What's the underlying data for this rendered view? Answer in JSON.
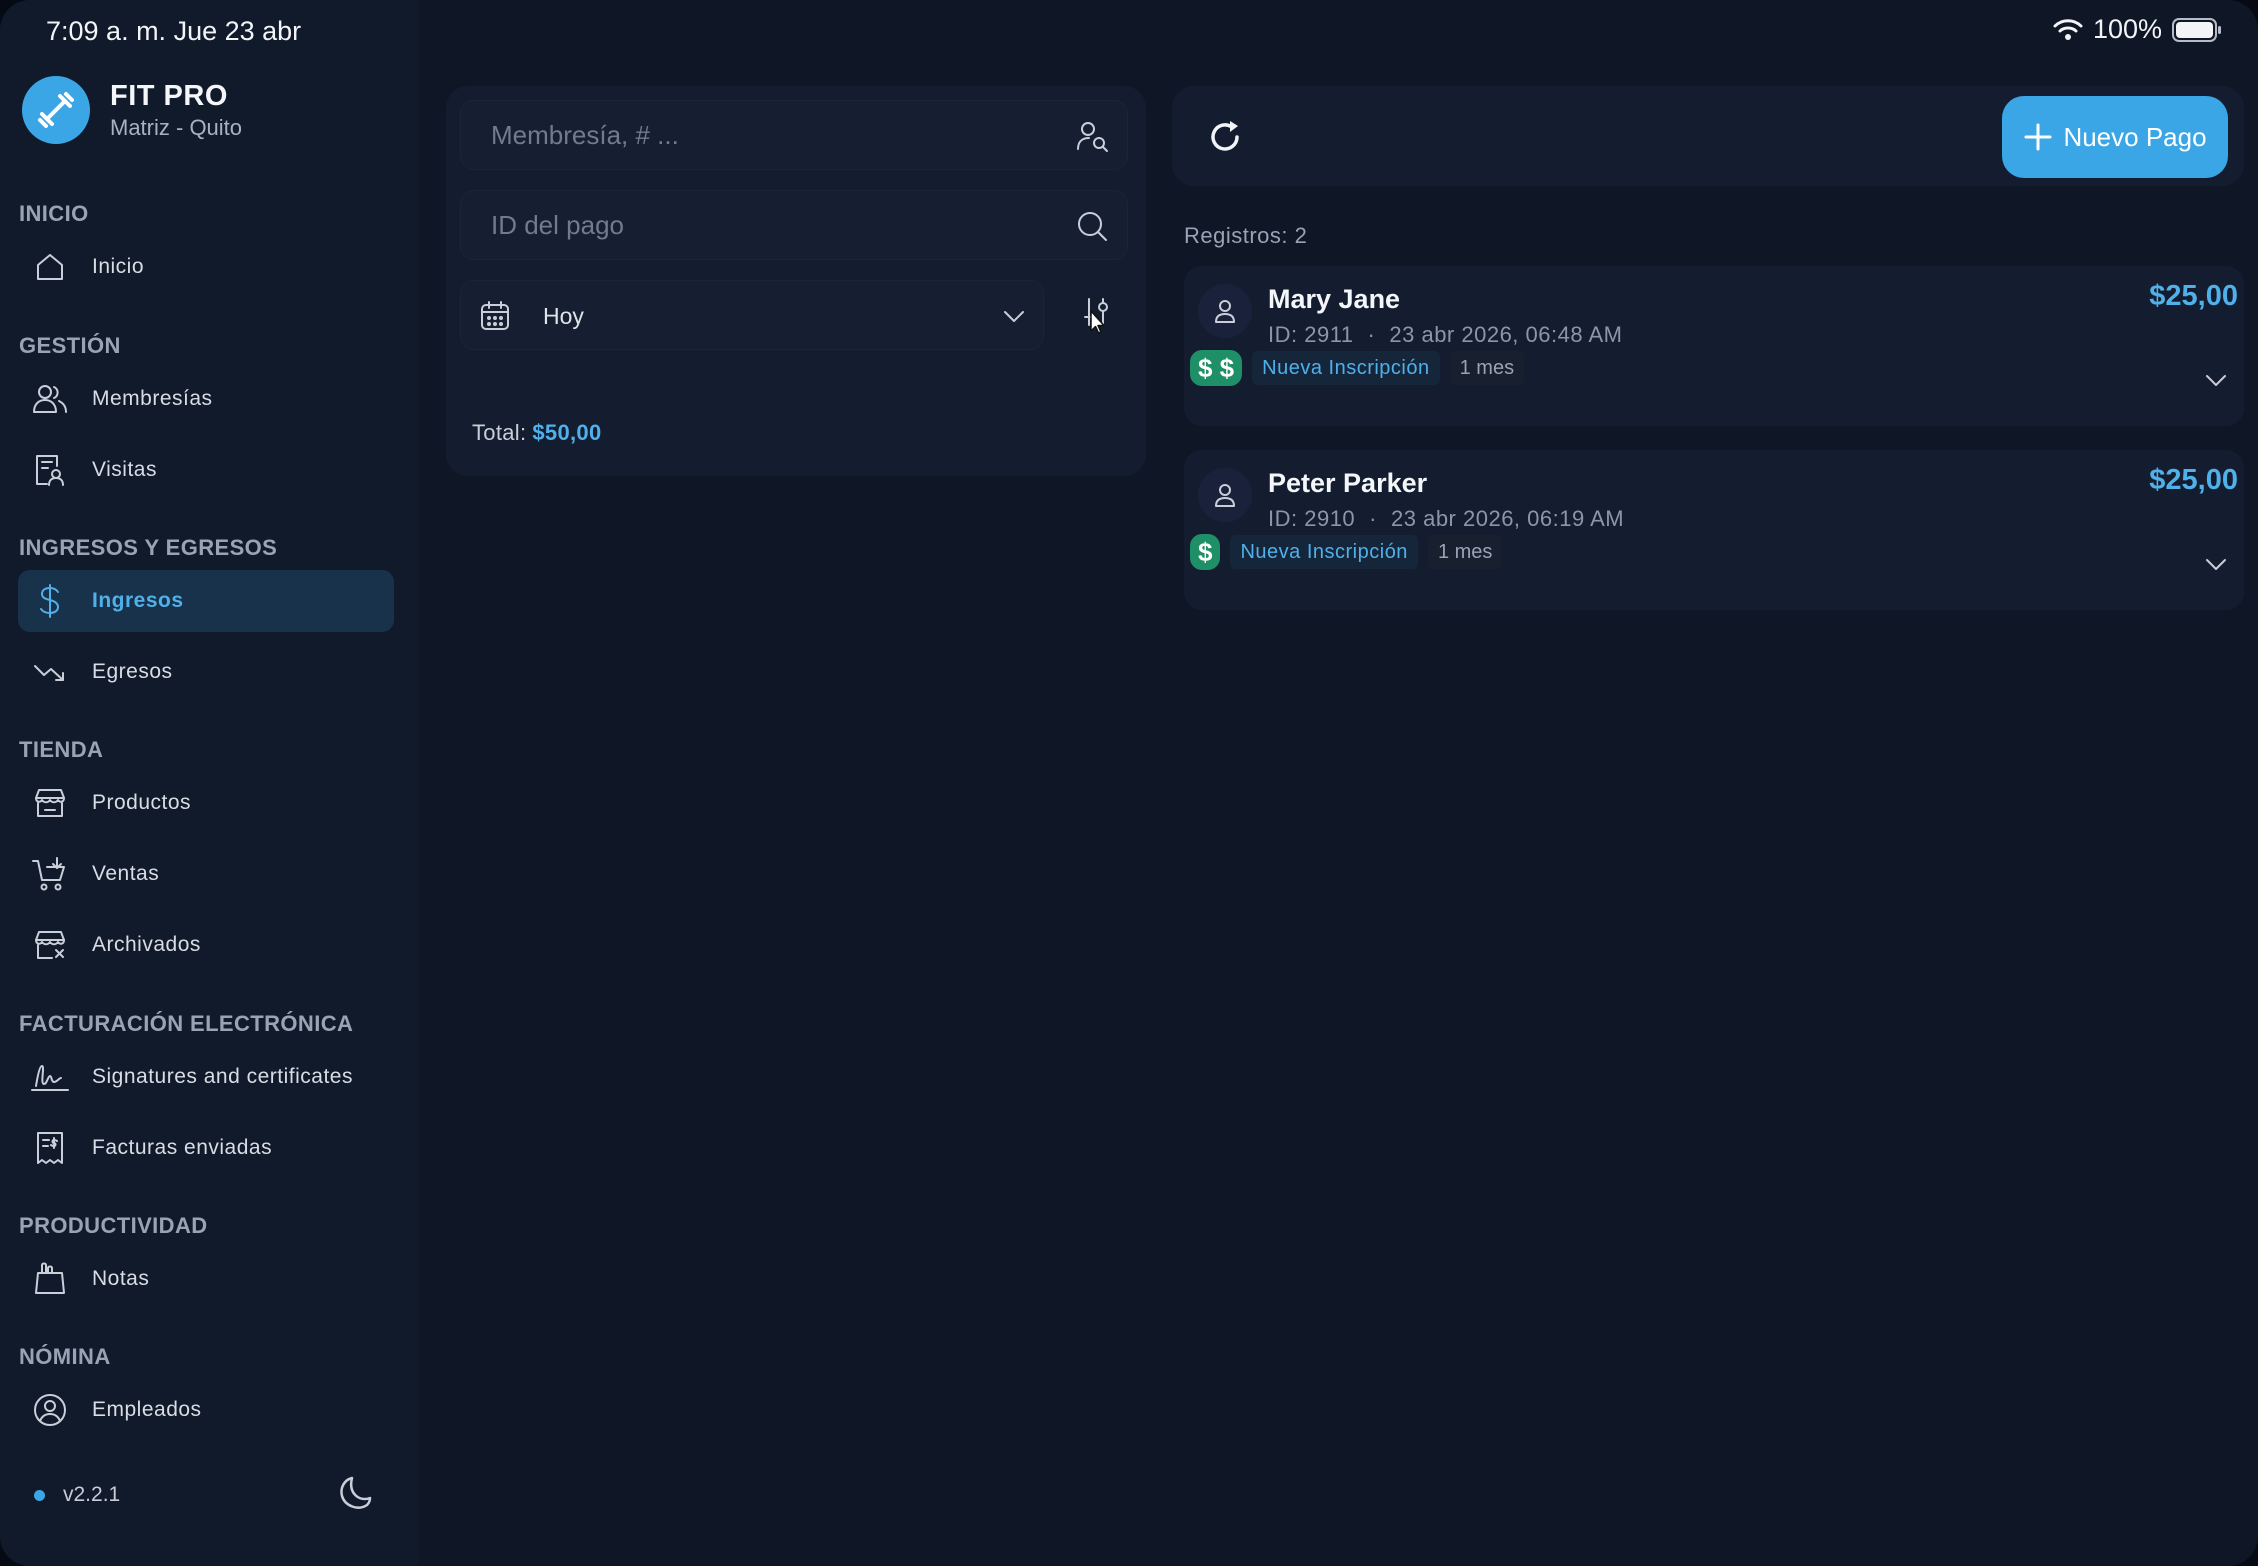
{
  "status_bar": {
    "time": "7:09 a. m.  Jue 23 abr",
    "battery": "100%"
  },
  "brand": {
    "name": "FIT PRO",
    "subtitle": "Matriz - Quito"
  },
  "sidebar": {
    "sections": [
      {
        "title": "INICIO",
        "items": [
          {
            "label": "Inicio",
            "icon": "home-icon"
          }
        ]
      },
      {
        "title": "GESTIÓN",
        "items": [
          {
            "label": "Membresías",
            "icon": "users-icon"
          },
          {
            "label": "Visitas",
            "icon": "visits-icon"
          }
        ]
      },
      {
        "title": "INGRESOS Y EGRESOS",
        "items": [
          {
            "label": "Ingresos",
            "icon": "dollar-icon",
            "active": true
          },
          {
            "label": "Egresos",
            "icon": "trend-down-icon"
          }
        ]
      },
      {
        "title": "TIENDA",
        "items": [
          {
            "label": "Productos",
            "icon": "store-icon"
          },
          {
            "label": "Ventas",
            "icon": "cart-icon"
          },
          {
            "label": "Archivados",
            "icon": "archive-store-icon"
          }
        ]
      },
      {
        "title": "FACTURACIÓN ELECTRÓNICA",
        "items": [
          {
            "label": "Signatures and certificates",
            "icon": "signature-icon"
          },
          {
            "label": "Facturas enviadas",
            "icon": "invoice-icon"
          }
        ]
      },
      {
        "title": "PRODUCTIVIDAD",
        "items": [
          {
            "label": "Notas",
            "icon": "notes-icon"
          }
        ]
      },
      {
        "title": "NÓMINA",
        "items": [
          {
            "label": "Empleados",
            "icon": "employee-icon"
          }
        ]
      }
    ],
    "version": "v2.2.1"
  },
  "filters": {
    "membership_placeholder": "Membresía, # ...",
    "payment_id_placeholder": "ID del pago",
    "date_range": "Hoy",
    "total_label": "Total:",
    "total_value": "$50,00"
  },
  "toolbar": {
    "new_payment_label": "Nuevo Pago"
  },
  "records_label": "Registros: 2",
  "payments": [
    {
      "name": "Mary Jane",
      "id": "ID: 2911",
      "datetime": "23 abr 2026, 06:48 AM",
      "amount": "$25,00",
      "method": "$ $",
      "type": "Nueva Inscripción",
      "period": "1 mes"
    },
    {
      "name": "Peter Parker",
      "id": "ID: 2910",
      "datetime": "23 abr 2026, 06:19 AM",
      "amount": "$25,00",
      "method": "$",
      "type": "Nueva Inscripción",
      "period": "1 mes"
    }
  ],
  "colors": {
    "accent": "#3aa6e6",
    "success": "#1f8f68",
    "background": "#0f1626",
    "panel": "#141d2f"
  }
}
